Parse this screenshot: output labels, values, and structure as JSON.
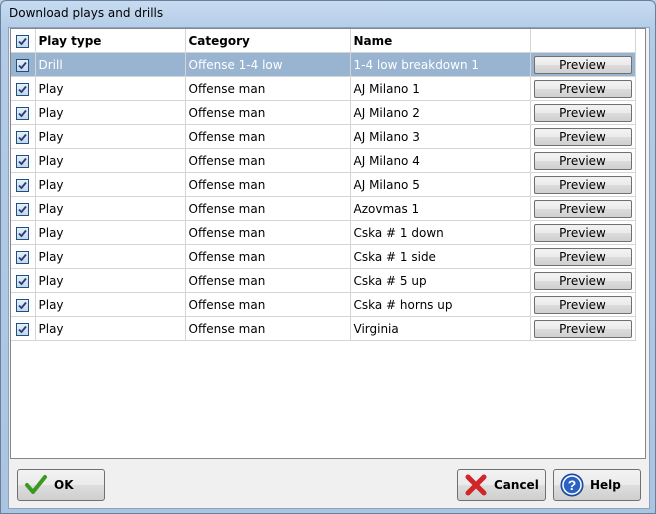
{
  "window": {
    "title": "Download plays and drills"
  },
  "table": {
    "columns": [
      "Play type",
      "Category",
      "Name",
      ""
    ],
    "header_checked": true,
    "rows": [
      {
        "type": "Drill",
        "category": "Offense 1-4 low",
        "name": "1-4 low breakdown 1",
        "checked": true,
        "selected": true,
        "action": "Preview"
      },
      {
        "type": "Play",
        "category": "Offense man",
        "name": "AJ Milano 1",
        "checked": true,
        "selected": false,
        "action": "Preview"
      },
      {
        "type": "Play",
        "category": "Offense man",
        "name": "AJ Milano 2",
        "checked": true,
        "selected": false,
        "action": "Preview"
      },
      {
        "type": "Play",
        "category": "Offense man",
        "name": "AJ Milano 3",
        "checked": true,
        "selected": false,
        "action": "Preview"
      },
      {
        "type": "Play",
        "category": "Offense man",
        "name": "AJ Milano 4",
        "checked": true,
        "selected": false,
        "action": "Preview"
      },
      {
        "type": "Play",
        "category": "Offense man",
        "name": "AJ Milano 5",
        "checked": true,
        "selected": false,
        "action": "Preview"
      },
      {
        "type": "Play",
        "category": "Offense man",
        "name": "Azovmas 1",
        "checked": true,
        "selected": false,
        "action": "Preview"
      },
      {
        "type": "Play",
        "category": "Offense man",
        "name": "Cska # 1 down",
        "checked": true,
        "selected": false,
        "action": "Preview"
      },
      {
        "type": "Play",
        "category": "Offense man",
        "name": "Cska # 1 side",
        "checked": true,
        "selected": false,
        "action": "Preview"
      },
      {
        "type": "Play",
        "category": "Offense man",
        "name": "Cska # 5 up",
        "checked": true,
        "selected": false,
        "action": "Preview"
      },
      {
        "type": "Play",
        "category": "Offense man",
        "name": "Cska # horns up",
        "checked": true,
        "selected": false,
        "action": "Preview"
      },
      {
        "type": "Play",
        "category": "Offense man",
        "name": "Virginia",
        "checked": true,
        "selected": false,
        "action": "Preview"
      }
    ]
  },
  "footer": {
    "ok_label": "OK",
    "cancel_label": "Cancel",
    "help_label": "Help"
  },
  "icons": {
    "ok": "checkmark-icon",
    "cancel": "red-x-icon",
    "help": "help-question-icon",
    "checkbox": "checkbox-checked-icon"
  },
  "colors": {
    "selection": "#99b4d1",
    "check_green": "#3a9a1f",
    "cancel_red": "#d0262a",
    "help_blue": "#2a62c4"
  }
}
